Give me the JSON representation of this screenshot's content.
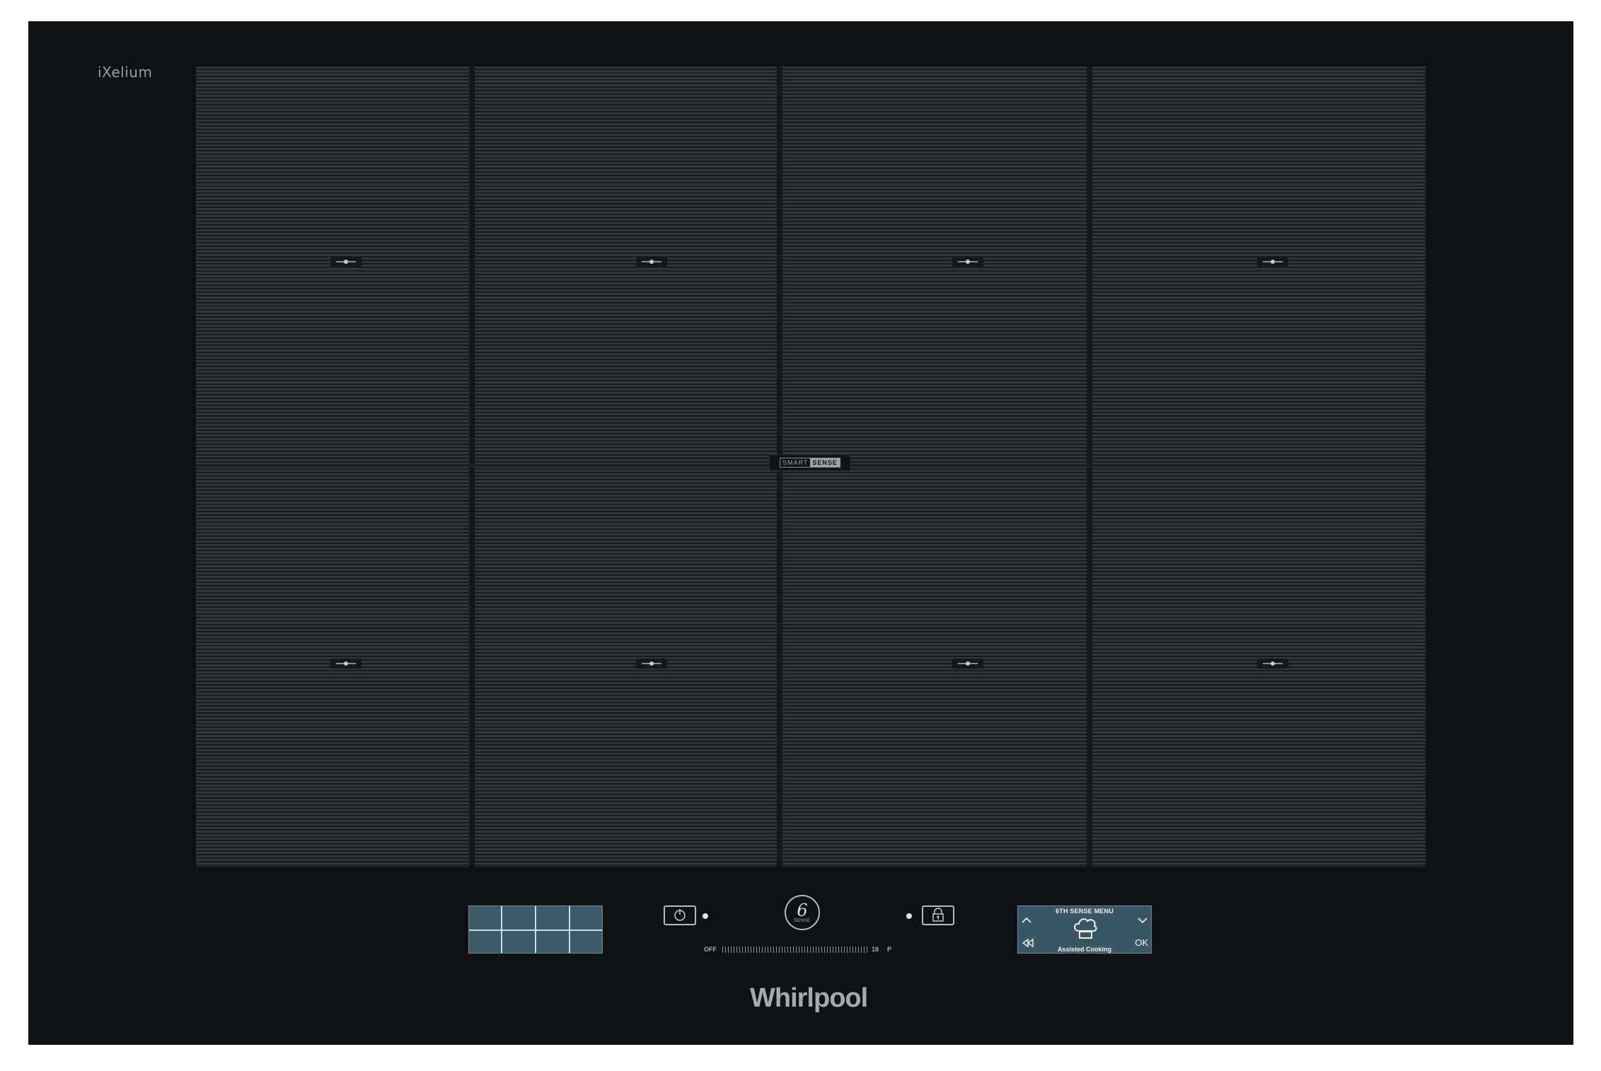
{
  "brand": {
    "series_logo": "iXelium",
    "maker_logo": "Whirlpool"
  },
  "surface": {
    "zones_grid": "4x2",
    "badge": {
      "part_a": "SMART",
      "part_b": "SENSE"
    }
  },
  "controls": {
    "zone_map_icon": "zone-grid-icon",
    "power_icon": "power-icon",
    "lock_icon": "lock-icon",
    "sixth_sense": {
      "number": "6",
      "label": "SENSE"
    },
    "power_slider": {
      "min_label": "OFF",
      "max_label": "18",
      "boost_label": "P"
    },
    "display": {
      "title": "6TH SENSE MENU",
      "caption": "Assisted Cooking",
      "ok_label": "OK",
      "icons": [
        "chevron-up-icon",
        "chevron-down-icon",
        "back-icon",
        "chef-hat-icon"
      ]
    }
  },
  "colors": {
    "cooktop_glass": "#101114",
    "surface_stripe": "#343537",
    "display_bg": "#3b5862",
    "label_gray": "#a7a9ad"
  }
}
